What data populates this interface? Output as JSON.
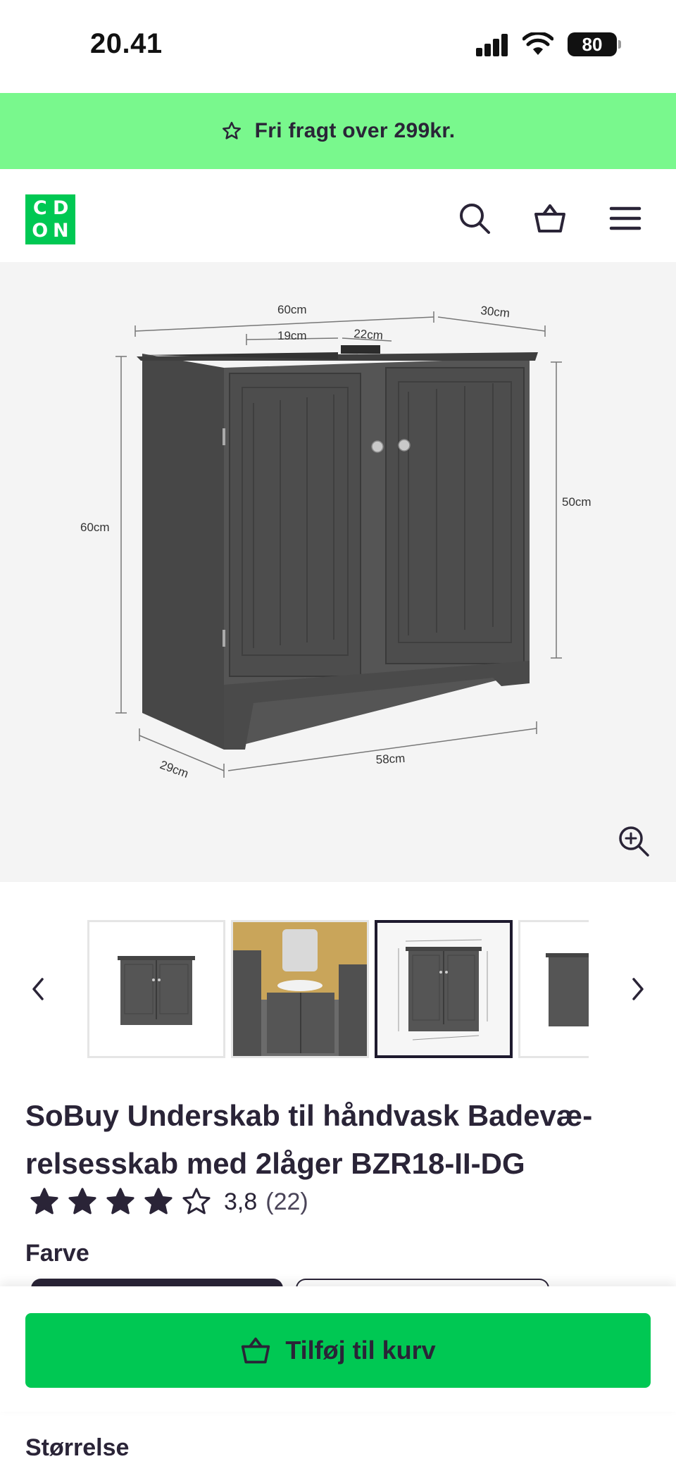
{
  "status_bar": {
    "time": "20.41",
    "battery": "80"
  },
  "promo": {
    "text": "Fri fragt over 299kr.",
    "icon": "star-outline-icon"
  },
  "header": {
    "logo_letters": [
      "C",
      "D",
      "O",
      "N"
    ],
    "icons": [
      "search-icon",
      "basket-icon",
      "menu-icon"
    ]
  },
  "main_image": {
    "alt": "Dark grey under-sink cabinet with dimensions",
    "dimensions": {
      "top_width": "60cm",
      "depth_top": "30cm",
      "cutout_left": "19cm",
      "cutout_right": "22cm",
      "height_left": "60cm",
      "height_right": "50cm",
      "base_depth": "29cm",
      "base_width": "58cm"
    },
    "zoom_icon": "zoom-in-icon"
  },
  "thumbnails": {
    "prev_icon": "chevron-left-icon",
    "next_icon": "chevron-right-icon",
    "selected_index": 2
  },
  "product": {
    "title_line1": "SoBuy Underskab til håndvask Badevæ-",
    "title_line2": "relsesskab med 2låger BZR18-II-DG",
    "rating": 3.8,
    "rating_display": "3,8",
    "review_count": "(22)",
    "color_label": "Farve",
    "size_label": "Størrelse"
  },
  "cart": {
    "button_label": "Tilføj til kurv",
    "icon": "basket-icon"
  },
  "colors": {
    "accent_green": "#00c853",
    "promo_green": "#79f88d",
    "text_dark": "#2a2437"
  }
}
